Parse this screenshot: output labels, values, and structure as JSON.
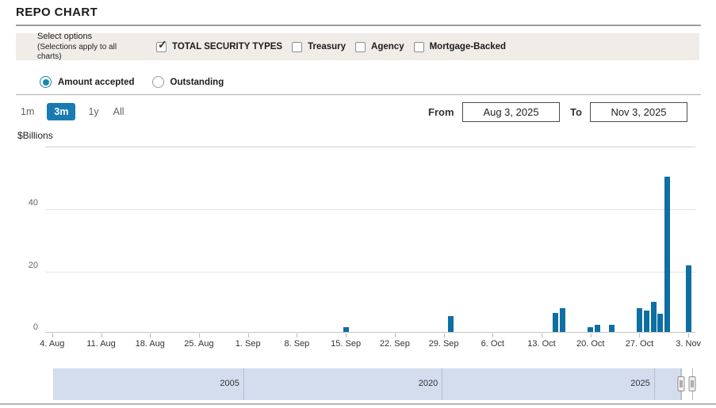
{
  "header": {
    "title": "REPO CHART"
  },
  "options_bar": {
    "label_line1": "Select options",
    "label_line2": "(Selections apply to all charts)",
    "check_icon": "✓",
    "checkboxes": [
      {
        "label": "TOTAL SECURITY TYPES",
        "checked": true
      },
      {
        "label": "Treasury",
        "checked": false
      },
      {
        "label": "Agency",
        "checked": false
      },
      {
        "label": "Mortgage-Backed",
        "checked": false
      }
    ]
  },
  "series_toggle": [
    {
      "label": "Amount accepted",
      "selected": true
    },
    {
      "label": "Outstanding",
      "selected": false
    }
  ],
  "range_selector": {
    "ranges": [
      {
        "label": "1m",
        "active": false
      },
      {
        "label": "3m",
        "active": true
      },
      {
        "label": "1y",
        "active": false
      },
      {
        "label": "All",
        "active": false
      }
    ],
    "from_label": "From",
    "from_value": "Aug 3, 2025",
    "to_label": "To",
    "to_value": "Nov 3, 2025"
  },
  "chart_data": {
    "type": "bar",
    "title": "REPO CHART",
    "ylabel": "$Billions",
    "ylim": [
      0,
      60
    ],
    "yticks": [
      0,
      20,
      40
    ],
    "grid": true,
    "legend": "none",
    "x_range": {
      "min": "Aug 3, 2025",
      "max": "Nov 4, 2025",
      "days": 93
    },
    "x_ticks": [
      {
        "label": "4. Aug",
        "day": 1
      },
      {
        "label": "11. Aug",
        "day": 8
      },
      {
        "label": "18. Aug",
        "day": 15
      },
      {
        "label": "25. Aug",
        "day": 22
      },
      {
        "label": "1. Sep",
        "day": 29
      },
      {
        "label": "8. Sep",
        "day": 36
      },
      {
        "label": "15. Sep",
        "day": 43
      },
      {
        "label": "22. Sep",
        "day": 50
      },
      {
        "label": "29. Sep",
        "day": 57
      },
      {
        "label": "6. Oct",
        "day": 64
      },
      {
        "label": "13. Oct",
        "day": 71
      },
      {
        "label": "20. Oct",
        "day": 78
      },
      {
        "label": "27. Oct",
        "day": 85
      },
      {
        "label": "3. Nov",
        "day": 92
      }
    ],
    "bars": [
      {
        "date": "Sep 15, 2025",
        "day": 43,
        "value": 1.5
      },
      {
        "date": "Sep 30, 2025",
        "day": 58,
        "value": 5.0
      },
      {
        "date": "Oct 15, 2025",
        "day": 73,
        "value": 6.1
      },
      {
        "date": "Oct 16, 2025",
        "day": 74,
        "value": 7.6
      },
      {
        "date": "Oct 20, 2025",
        "day": 78,
        "value": 1.6
      },
      {
        "date": "Oct 21, 2025",
        "day": 79,
        "value": 2.4
      },
      {
        "date": "Oct 23, 2025",
        "day": 81,
        "value": 2.2
      },
      {
        "date": "Oct 27, 2025",
        "day": 85,
        "value": 7.7
      },
      {
        "date": "Oct 28, 2025",
        "day": 86,
        "value": 7.0
      },
      {
        "date": "Oct 29, 2025",
        "day": 87,
        "value": 9.7
      },
      {
        "date": "Oct 30, 2025",
        "day": 88,
        "value": 6.0
      },
      {
        "date": "Oct 31, 2025",
        "day": 89,
        "value": 50.0
      },
      {
        "date": "Nov 3, 2025",
        "day": 92,
        "value": 21.5
      }
    ],
    "colors": {
      "bar": "#0e6fa1",
      "accent_blue": "#1a7ab2",
      "radio_teal": "#1a86ad"
    }
  },
  "navigator": {
    "year_ticks": [
      {
        "label": "2005",
        "pct": 29.5
      },
      {
        "label": "2020",
        "pct": 60.3
      },
      {
        "label": "2025",
        "pct": 93.2
      }
    ],
    "selection": {
      "mask_end_pct": 97.4,
      "window_end_pct": 99.15
    }
  }
}
